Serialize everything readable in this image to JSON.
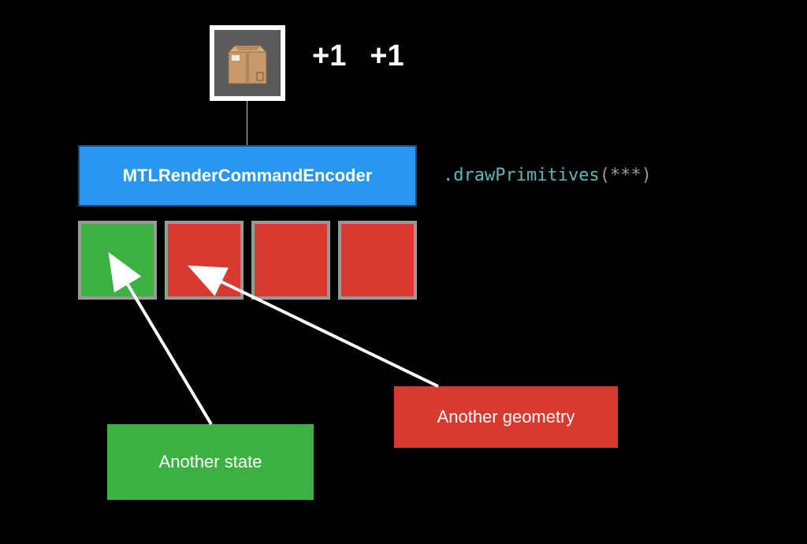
{
  "top": {
    "icon_name": "package-box-icon",
    "plus_labels": [
      "+1",
      "+1"
    ]
  },
  "encoder": {
    "label": "MTLRenderCommandEncoder"
  },
  "method": {
    "prefix": ".",
    "name": "drawPrimitives",
    "args": "(***)"
  },
  "commands": {
    "cells": [
      {
        "color": "green"
      },
      {
        "color": "red"
      },
      {
        "color": "red"
      },
      {
        "color": "red"
      }
    ]
  },
  "annotations": {
    "state_label": "Another state",
    "geometry_label": "Another geometry"
  }
}
